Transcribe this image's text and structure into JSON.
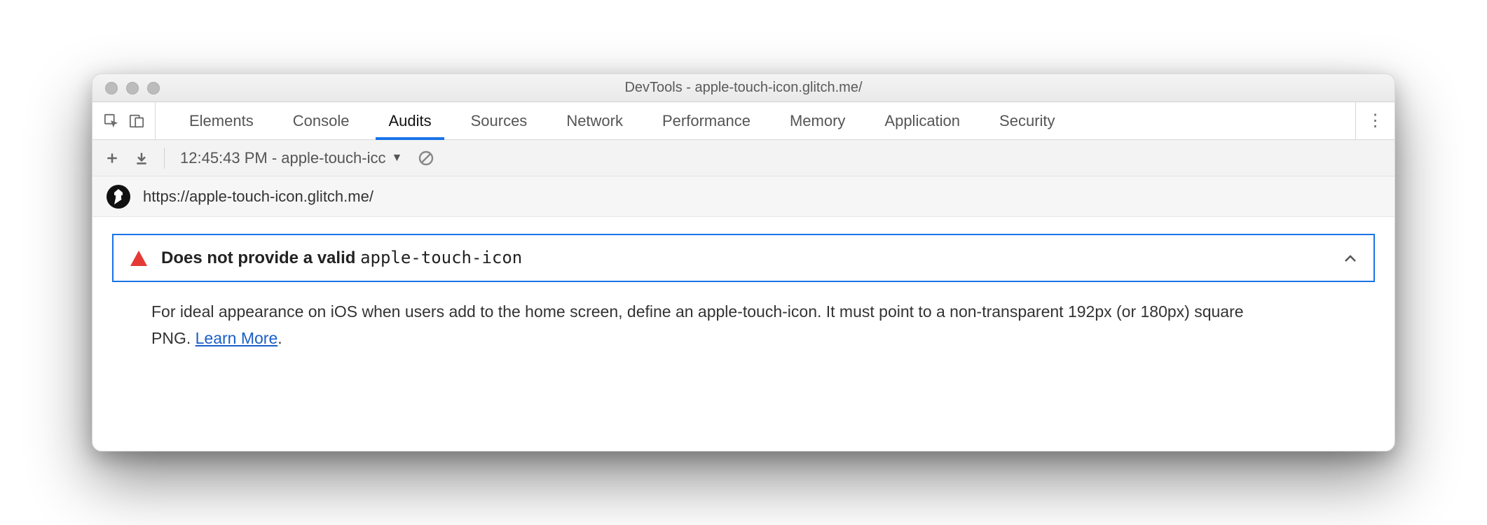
{
  "window": {
    "title": "DevTools - apple-touch-icon.glitch.me/"
  },
  "tabs": {
    "items": [
      "Elements",
      "Console",
      "Audits",
      "Sources",
      "Network",
      "Performance",
      "Memory",
      "Application",
      "Security"
    ],
    "active_index": 2
  },
  "toolbar": {
    "dropdown_label": "12:45:43 PM - apple-touch-icc"
  },
  "url_row": {
    "url": "https://apple-touch-icon.glitch.me/"
  },
  "audit": {
    "title_prefix": "Does not provide a valid ",
    "title_code": "apple-touch-icon",
    "description": "For ideal appearance on iOS when users add to the home screen, define an apple-touch-icon. It must point to a non-transparent 192px (or 180px) square PNG. ",
    "learn_more": "Learn More",
    "period": "."
  }
}
